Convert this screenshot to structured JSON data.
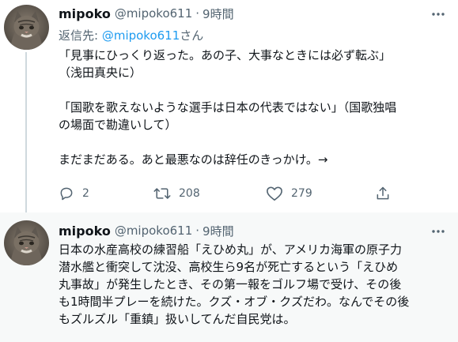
{
  "tweets": [
    {
      "name": "mipoko",
      "handle": "@mipoko611",
      "dot": "·",
      "time": "9時間",
      "reply_prefix": "返信先: ",
      "reply_mention": "@mipoko611",
      "reply_suffix": "さん",
      "text": "「見事にひっくり返った。あの子、大事なときには必ず転ぶ」\n（浅田真央に）\n\n「国歌を歌えないような選手は日本の代表ではない」（国歌独唱\nの場面で勘違いして）\n\nまだまだある。あと最悪なのは辞任のきっかけ。→",
      "actions": {
        "reply_count": "2",
        "retweet_count": "208",
        "like_count": "279"
      }
    },
    {
      "name": "mipoko",
      "handle": "@mipoko611",
      "dot": "·",
      "time": "9時間",
      "text": "日本の水産高校の練習船「えひめ丸」が、アメリカ海軍の原子力\n潜水艦と衝突して沈没、高校生ら9名が死亡するという「えひめ\n丸事故」が発生したとき、その第一報をゴルフ場で受け、その後\nも1時間半プレーを続けた。クズ・オブ・クズだわ。なんでその後\nもズルズル「重鎮」扱いしてんだ自民党は。"
    }
  ],
  "icons": {
    "more": "more-horizontal-icon",
    "reply": "reply-icon",
    "retweet": "retweet-icon",
    "like": "like-icon",
    "share": "share-icon"
  },
  "colors": {
    "text_primary": "#0f1419",
    "text_secondary": "#536471",
    "link": "#1d9bf0",
    "thread_line": "#cfd9de",
    "second_tweet_bg": "#f7f9f9"
  }
}
